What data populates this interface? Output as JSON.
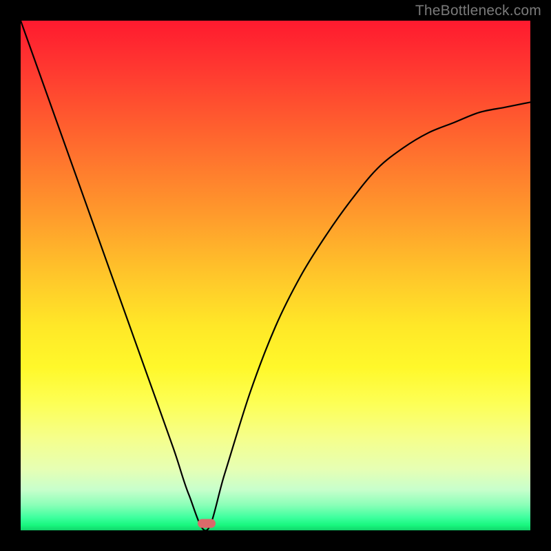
{
  "watermark": "TheBottleneck.com",
  "marker": {
    "x_frac": 0.365,
    "y_frac": 0.986
  },
  "chart_data": {
    "type": "line",
    "title": "",
    "xlabel": "",
    "ylabel": "",
    "xlim": [
      0,
      1
    ],
    "ylim": [
      0,
      1
    ],
    "series": [
      {
        "name": "bottleneck-curve",
        "x": [
          0.0,
          0.05,
          0.1,
          0.15,
          0.2,
          0.25,
          0.3,
          0.33,
          0.365,
          0.4,
          0.45,
          0.5,
          0.55,
          0.6,
          0.65,
          0.7,
          0.75,
          0.8,
          0.85,
          0.9,
          0.95,
          1.0
        ],
        "y": [
          1.0,
          0.86,
          0.72,
          0.58,
          0.44,
          0.3,
          0.16,
          0.07,
          0.0,
          0.11,
          0.27,
          0.4,
          0.5,
          0.58,
          0.65,
          0.71,
          0.75,
          0.78,
          0.8,
          0.82,
          0.83,
          0.84
        ]
      }
    ],
    "annotations": [
      {
        "type": "marker",
        "shape": "pill",
        "x": 0.365,
        "y": 0.0,
        "color": "#d96a6a"
      }
    ],
    "background_gradient": {
      "direction": "vertical",
      "stops": [
        {
          "pos": 0.0,
          "color": "#ff1a2f"
        },
        {
          "pos": 0.5,
          "color": "#ffc62a"
        },
        {
          "pos": 0.75,
          "color": "#fdff55"
        },
        {
          "pos": 1.0,
          "color": "#12d46a"
        }
      ]
    }
  }
}
